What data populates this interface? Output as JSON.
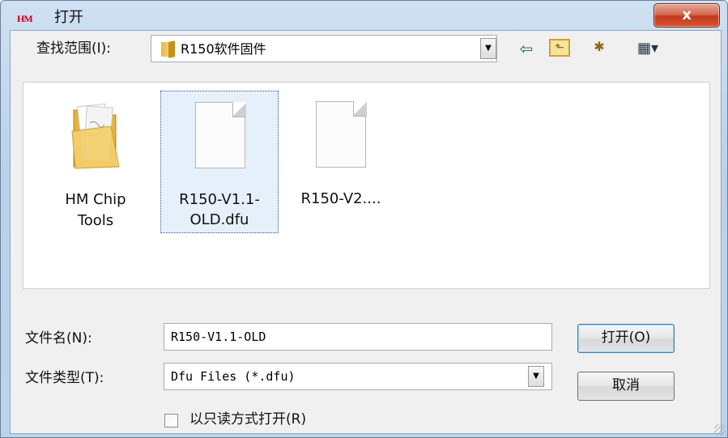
{
  "window": {
    "app_icon_text": "HM",
    "title": "打开",
    "close_icon": "close-icon",
    "close_glyph": "x"
  },
  "lookin": {
    "label": "查找范围(I):",
    "value": "R150软件固件",
    "folder_icon": "folder-icon",
    "dropdown_glyph": "▼"
  },
  "toolbar": {
    "back_icon": "back-arrow-icon",
    "back_glyph": "⇦",
    "up_icon": "up-folder-icon",
    "up_glyph": "⬑",
    "new_folder_icon": "new-folder-icon",
    "new_folder_glyph": "✱",
    "view_menu_icon": "view-menu-icon",
    "view_glyph": "▦▾"
  },
  "files": [
    {
      "name": "HM Chip Tools",
      "line1": "HM Chip",
      "line2": "Tools",
      "type": "folder",
      "selected": false
    },
    {
      "name": "R150-V1.1-OLD.dfu",
      "line1": "R150-V1.1-",
      "line2": "OLD.dfu",
      "type": "file",
      "selected": true
    },
    {
      "name": "R150-V2....",
      "line1": "R150-V2....",
      "line2": "",
      "type": "file",
      "selected": false
    }
  ],
  "filename": {
    "label": "文件名(N):",
    "value": "R150-V1.1-OLD"
  },
  "filetype": {
    "label": "文件类型(T):",
    "value": "Dfu Files (*.dfu)",
    "dropdown_glyph": "▼"
  },
  "buttons": {
    "open": "打开(O)",
    "cancel": "取消"
  },
  "readonly": {
    "label": "以只读方式打开(R)",
    "checked": false
  },
  "colors": {
    "accent": "#3c7fb1",
    "close_button": "#c2391d",
    "selection": "#e6f0fb"
  }
}
